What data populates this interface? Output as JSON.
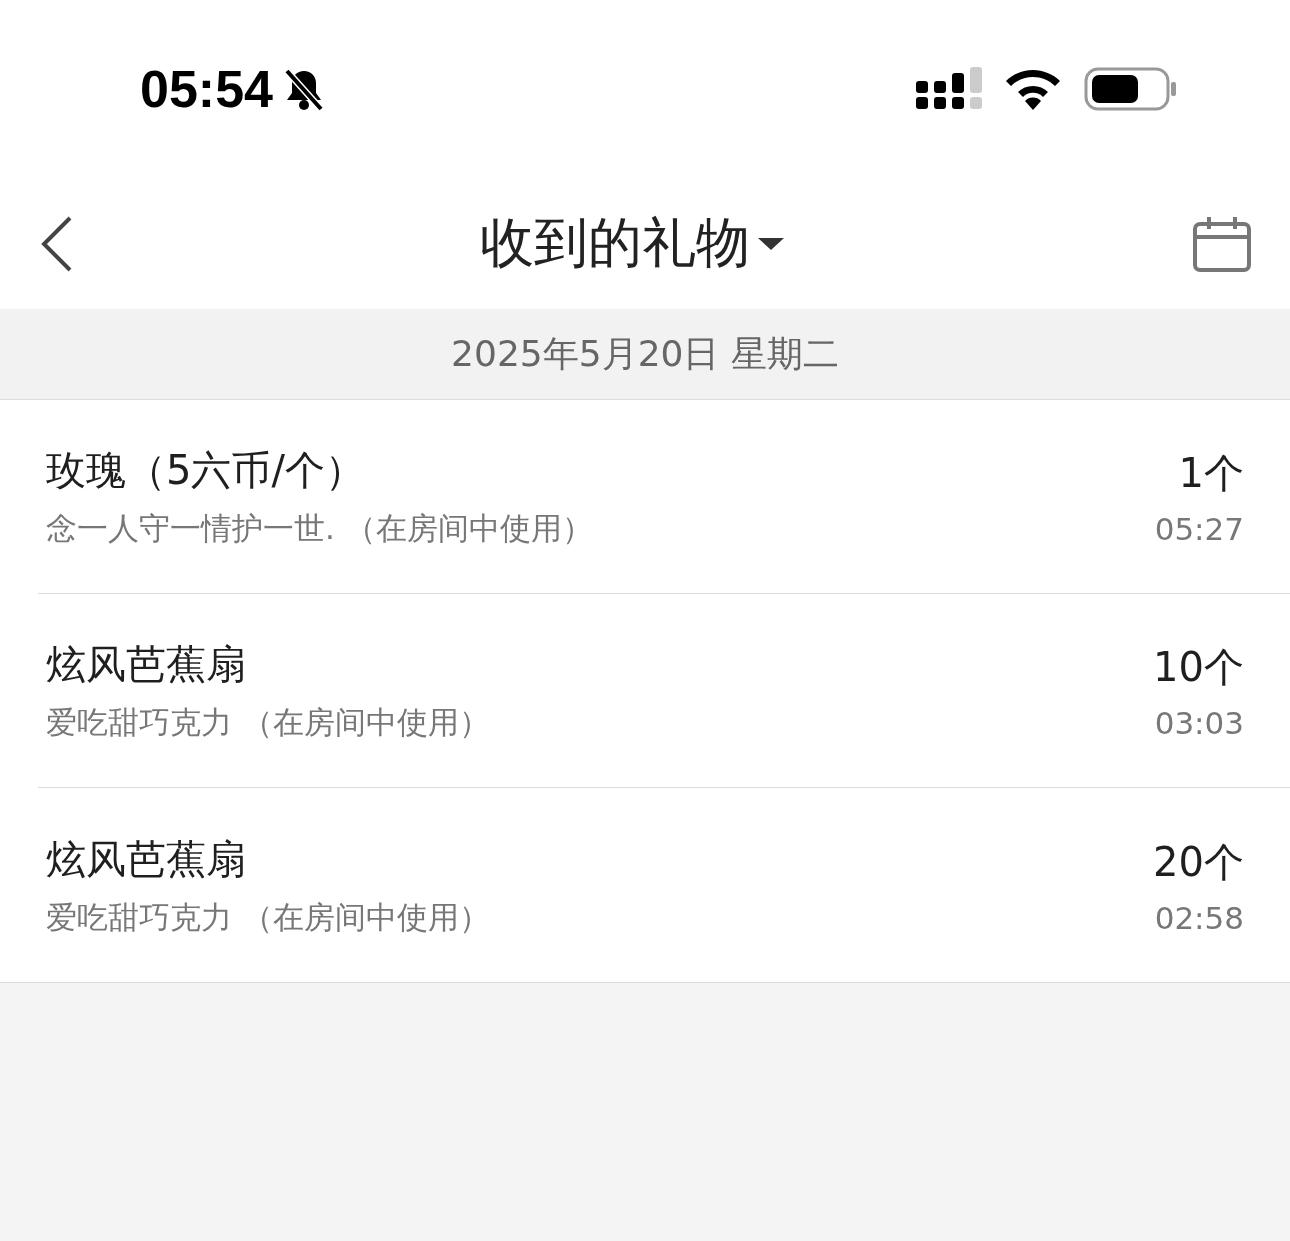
{
  "status_bar": {
    "time": "05:54"
  },
  "nav": {
    "title": "收到的礼物"
  },
  "date_header": "2025年5月20日 星期二",
  "gifts": [
    {
      "name": "玫瑰（5六币/个）",
      "note": "念一人守一情护一世. （在房间中使用）",
      "count": "1个",
      "time": "05:27"
    },
    {
      "name": "炫风芭蕉扇",
      "note": "爱吃甜巧克力 （在房间中使用）",
      "count": "10个",
      "time": "03:03"
    },
    {
      "name": "炫风芭蕉扇",
      "note": "爱吃甜巧克力 （在房间中使用）",
      "count": "20个",
      "time": "02:58"
    }
  ]
}
